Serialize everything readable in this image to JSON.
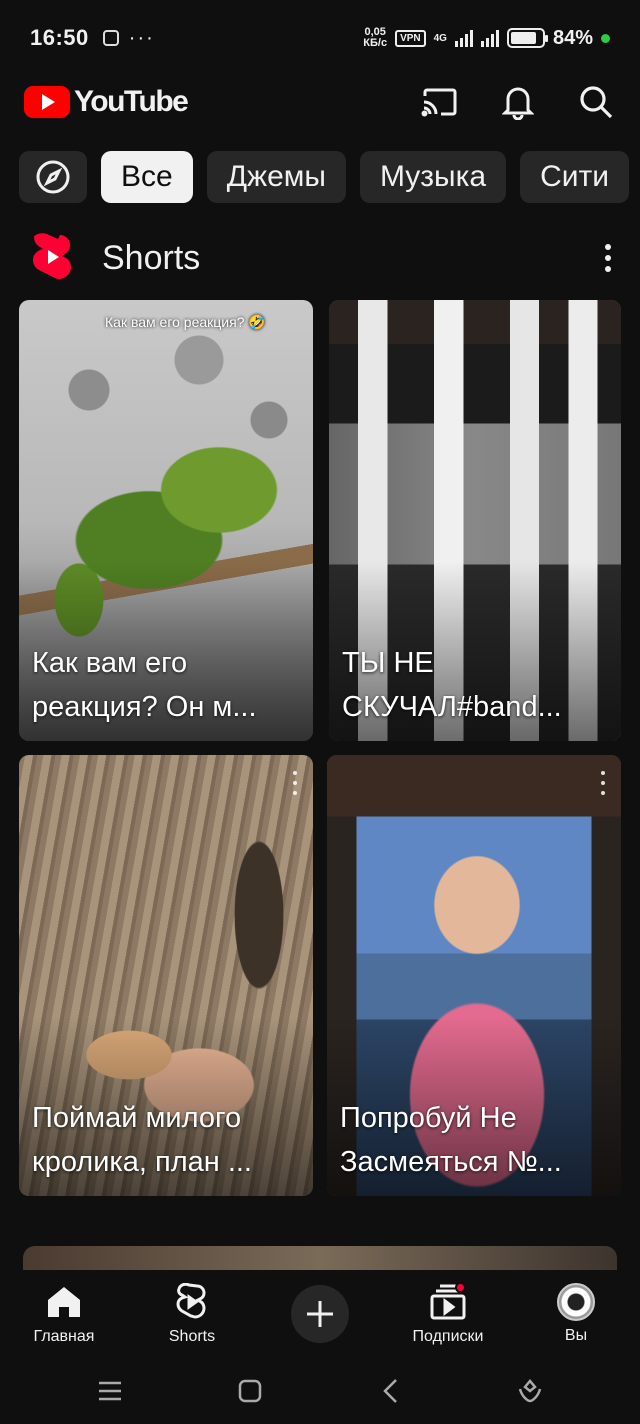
{
  "status_bar": {
    "time": "16:50",
    "dots": "···",
    "speed_value": "0,05",
    "speed_unit": "КБ/с",
    "vpn": "VPN",
    "network": "4G",
    "battery": "84%",
    "battery_level": 0.84,
    "accent_dot_color": "#2ecc40"
  },
  "header": {
    "logo_text": "YouTube",
    "actions": [
      "cast-icon",
      "bell-icon",
      "search-icon"
    ]
  },
  "chips": {
    "explore_icon": "compass-icon",
    "items": [
      {
        "label": "Все",
        "active": true
      },
      {
        "label": "Джемы",
        "active": false
      },
      {
        "label": "Музыка",
        "active": false
      },
      {
        "label": "Сити",
        "active": false
      }
    ]
  },
  "shorts": {
    "title": "Shorts",
    "items": [
      {
        "title": "Как вам его реакция? Он мимишный или нет?",
        "display": "Как вам его реакция? Он м...",
        "overlay": "Как вам его реакция? 🤣"
      },
      {
        "title": "ТЫ НЕ СКУЧАЛ#band",
        "display": "ТЫ НЕ СКУЧАЛ#band..."
      },
      {
        "title": "Поймай милого кролика, план ...",
        "display": "Поймай милого кролика, план ..."
      },
      {
        "title": "Попробуй Не Засмеяться №...",
        "display": "Попробуй Не Засмеяться №..."
      }
    ]
  },
  "bottom_nav": {
    "items": [
      {
        "label": "Главная",
        "icon": "home-icon"
      },
      {
        "label": "Shorts",
        "icon": "shorts-icon"
      },
      {
        "label": "",
        "icon": "plus-icon"
      },
      {
        "label": "Подписки",
        "icon": "subscriptions-icon"
      },
      {
        "label": "Вы",
        "icon": "avatar"
      }
    ]
  },
  "colors": {
    "background": "#0f0f0f",
    "chip": "#272727",
    "brand_red": "#ff0000"
  }
}
